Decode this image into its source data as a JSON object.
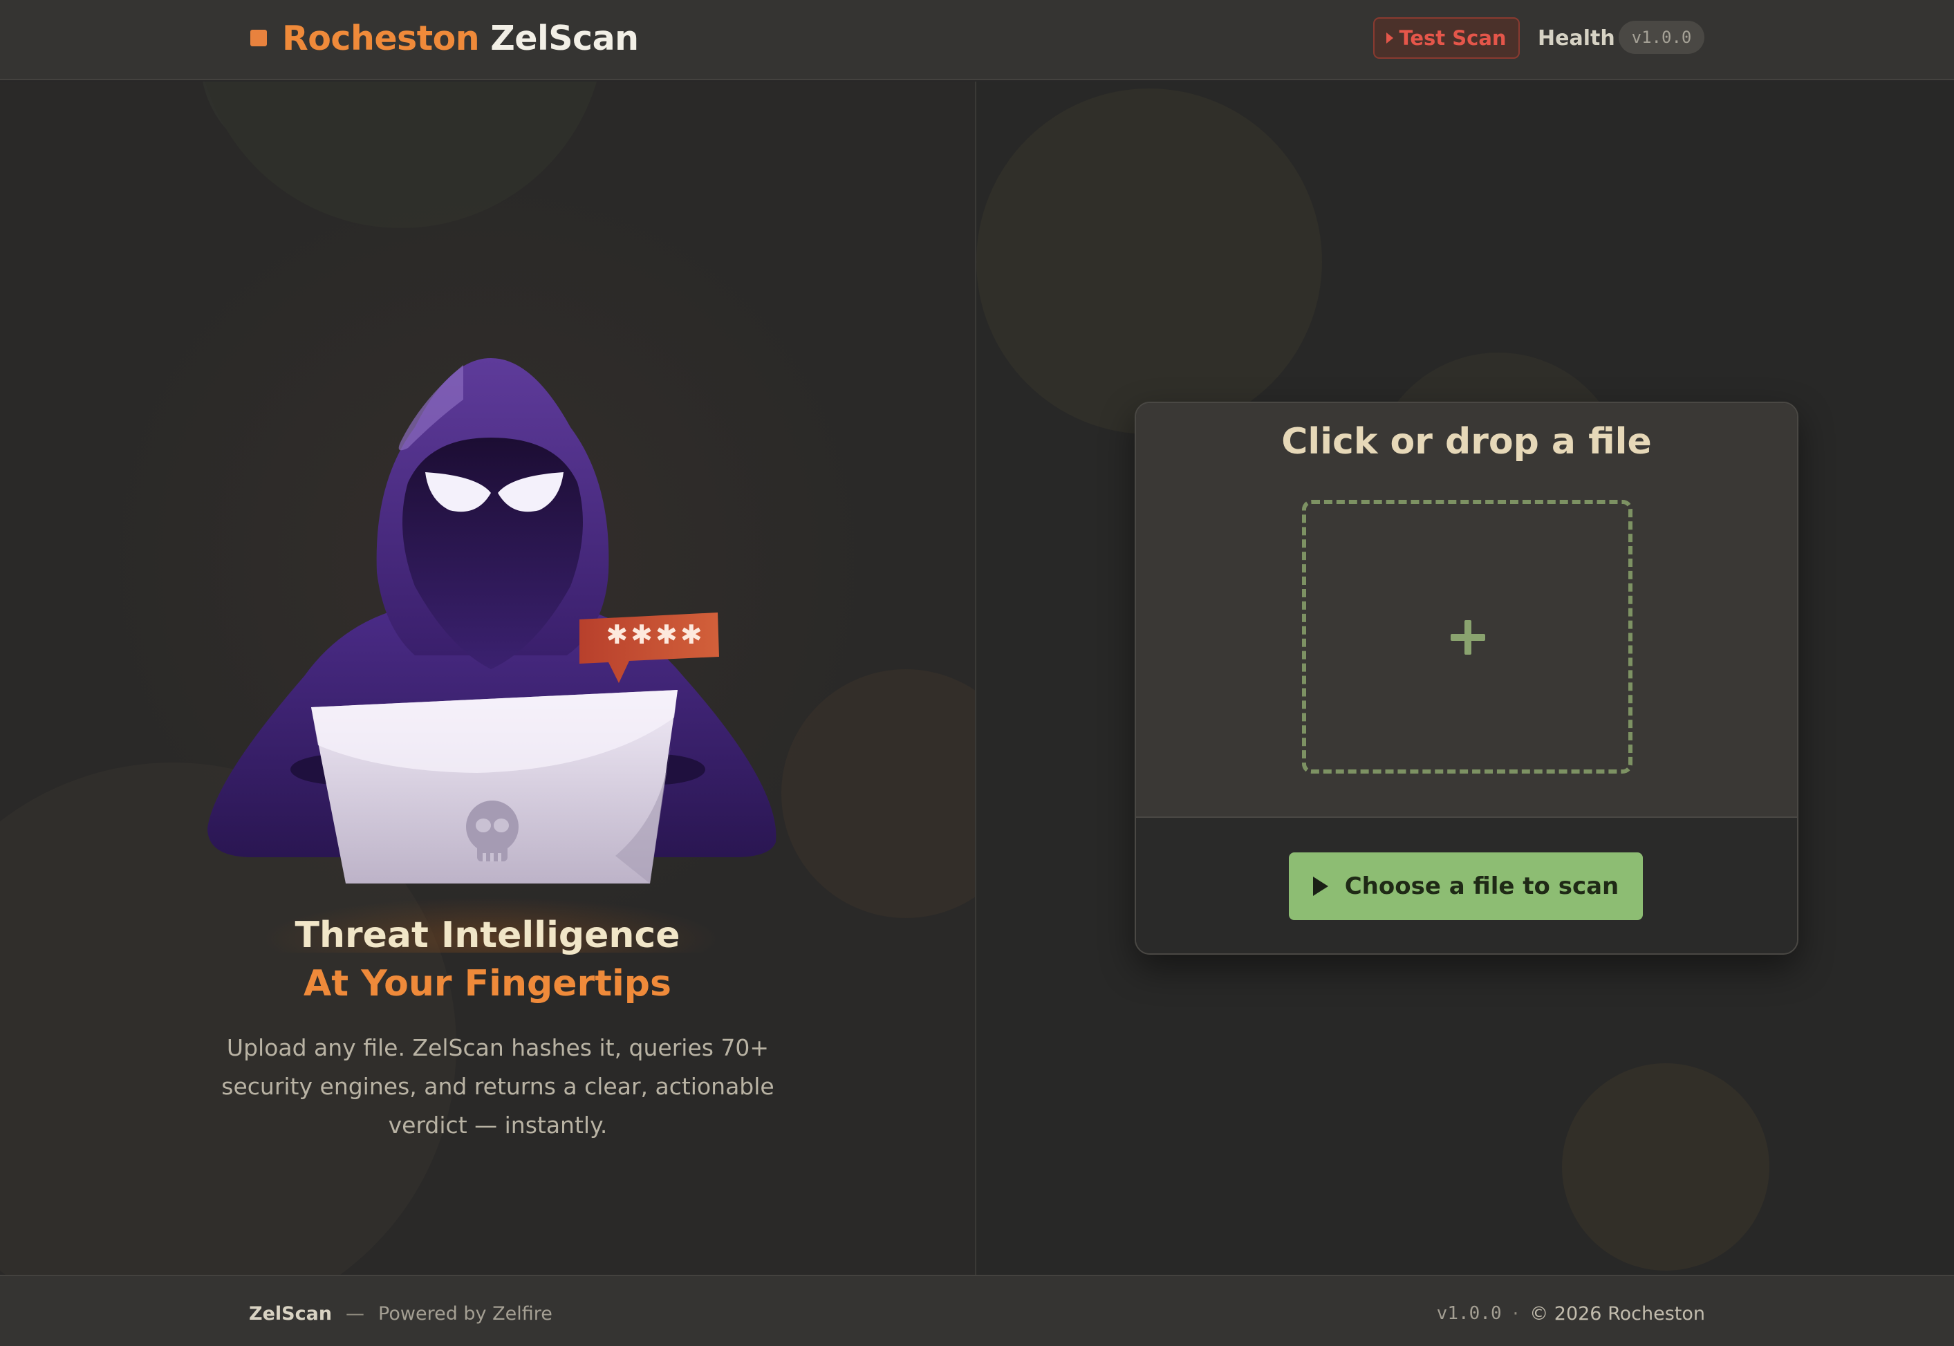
{
  "header": {
    "brand_primary": "Rocheston",
    "brand_secondary": "ZelScan",
    "test_scan_label": "Test Scan",
    "health_label": "Health",
    "version": "v1.0.0"
  },
  "hero": {
    "password_mask": "✱✱✱✱",
    "title_line1": "Threat Intelligence",
    "title_line2": "At Your Fingertips",
    "description": "Upload any file. ZelScan hashes it, queries 70+ security engines, and returns a clear, actionable verdict — instantly."
  },
  "upload": {
    "title": "Click or drop a file",
    "button_label": "Choose a file to scan"
  },
  "footer": {
    "brand": "ZelScan",
    "separator": "—",
    "powered_by": "Powered by Zelfire",
    "version": "v1.0.0",
    "dot": "·",
    "copyright": "© 2026 Rocheston"
  },
  "colors": {
    "accent_orange": "#ef8a3a",
    "danger_red": "#e5564a",
    "action_green": "#8dbd73",
    "background": "#282828"
  }
}
